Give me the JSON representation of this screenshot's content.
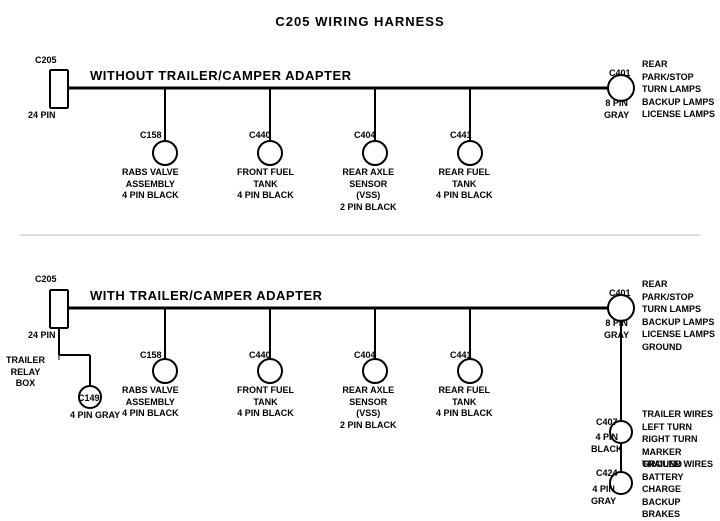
{
  "title": "C205 WIRING HARNESS",
  "section1": {
    "label": "WITHOUT  TRAILER/CAMPER ADAPTER",
    "connectors": [
      {
        "id": "C205_1",
        "label": "C205",
        "sublabel": "24 PIN",
        "type": "rect"
      },
      {
        "id": "C401_1",
        "label": "C401",
        "sublabel": "8 PIN\nGRAY",
        "type": "circle"
      },
      {
        "id": "C158_1",
        "label": "C158",
        "sublabel": "RABS VALVE\nASSEMBLY\n4 PIN BLACK"
      },
      {
        "id": "C440_1",
        "label": "C440",
        "sublabel": "FRONT FUEL\nTANK\n4 PIN BLACK"
      },
      {
        "id": "C404_1",
        "label": "C404",
        "sublabel": "REAR AXLE\nSENSOR\n(VSS)\n2 PIN BLACK"
      },
      {
        "id": "C441_1",
        "label": "C441",
        "sublabel": "REAR FUEL\nTANK\n4 PIN BLACK"
      }
    ],
    "right_label": "REAR PARK/STOP\nTURN LAMPS\nBACKUP LAMPS\nLICENSE LAMPS"
  },
  "section2": {
    "label": "WITH  TRAILER/CAMPER ADAPTER",
    "connectors": [
      {
        "id": "C205_2",
        "label": "C205",
        "sublabel": "24 PIN",
        "type": "rect"
      },
      {
        "id": "C401_2",
        "label": "C401",
        "sublabel": "8 PIN\nGRAY",
        "type": "circle"
      },
      {
        "id": "C158_2",
        "label": "C158",
        "sublabel": "RABS VALVE\nASSEMBLY\n4 PIN BLACK"
      },
      {
        "id": "C440_2",
        "label": "C440",
        "sublabel": "FRONT FUEL\nTANK\n4 PIN BLACK"
      },
      {
        "id": "C404_2",
        "label": "C404",
        "sublabel": "REAR AXLE\nSENSOR\n(VSS)\n2 PIN BLACK"
      },
      {
        "id": "C441_2",
        "label": "C441",
        "sublabel": "REAR FUEL\nTANK\n4 PIN BLACK"
      },
      {
        "id": "C149",
        "label": "C149",
        "sublabel": "4 PIN GRAY"
      },
      {
        "id": "C407",
        "label": "C407",
        "sublabel": "4 PIN\nBLACK"
      },
      {
        "id": "C424",
        "label": "C424",
        "sublabel": "4 PIN\nGRAY"
      }
    ],
    "right_label1": "REAR PARK/STOP\nTURN LAMPS\nBACKUP LAMPS\nLICENSE LAMPS\nGROUND",
    "right_label2": "TRAILER WIRES\nLEFT TURN\nRIGHT TURN\nMARKER\nGROUND",
    "right_label3": "TRAILER WIRES\nBATTERY CHARGE\nBACKUP\nBRAKES"
  }
}
